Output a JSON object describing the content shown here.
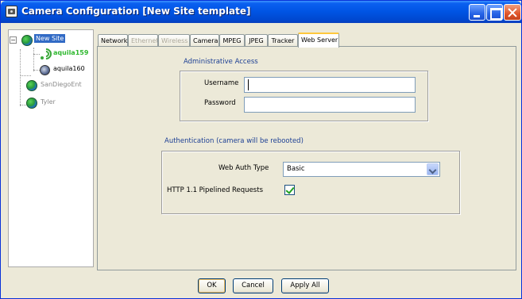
{
  "window": {
    "title": "Camera Configuration [New Site template]"
  },
  "tree": {
    "items": [
      {
        "label": "New Site",
        "type": "site",
        "selected": true,
        "expanded": true
      },
      {
        "label": "aquila159",
        "type": "wireless-camera",
        "color": "#2fb82f"
      },
      {
        "label": "aquila160",
        "type": "camera"
      },
      {
        "label": "SanDiegoEnt",
        "type": "site"
      },
      {
        "label": "Tyler",
        "type": "site"
      }
    ]
  },
  "tabs": [
    {
      "label": "Network",
      "enabled": true
    },
    {
      "label": "Ethernet",
      "enabled": false
    },
    {
      "label": "Wireless",
      "enabled": false
    },
    {
      "label": "Camera",
      "enabled": true
    },
    {
      "label": "MPEG",
      "enabled": true
    },
    {
      "label": "JPEG",
      "enabled": true
    },
    {
      "label": "Tracker",
      "enabled": true
    },
    {
      "label": "Web Server",
      "enabled": true,
      "active": true
    }
  ],
  "admin_access": {
    "title": "Administrative Access",
    "username_label": "Username",
    "username_value": "",
    "password_label": "Password",
    "password_value": ""
  },
  "authentication": {
    "title": "Authentication (camera will be rebooted)",
    "web_auth_type_label": "Web Auth Type",
    "web_auth_type_value": "Basic",
    "pipelined_label": "HTTP 1.1 Pipelined Requests",
    "pipelined_checked": true
  },
  "footer": {
    "ok_label": "OK",
    "cancel_label": "Cancel",
    "apply_all_label": "Apply All"
  },
  "colors": {
    "titlebar": "#0054e3",
    "window_bg": "#ece9d8",
    "group_title": "#1c3f94",
    "selection": "#316ac5",
    "wireless_node": "#2fb82f",
    "inactive_site": "#8a8a8a"
  }
}
